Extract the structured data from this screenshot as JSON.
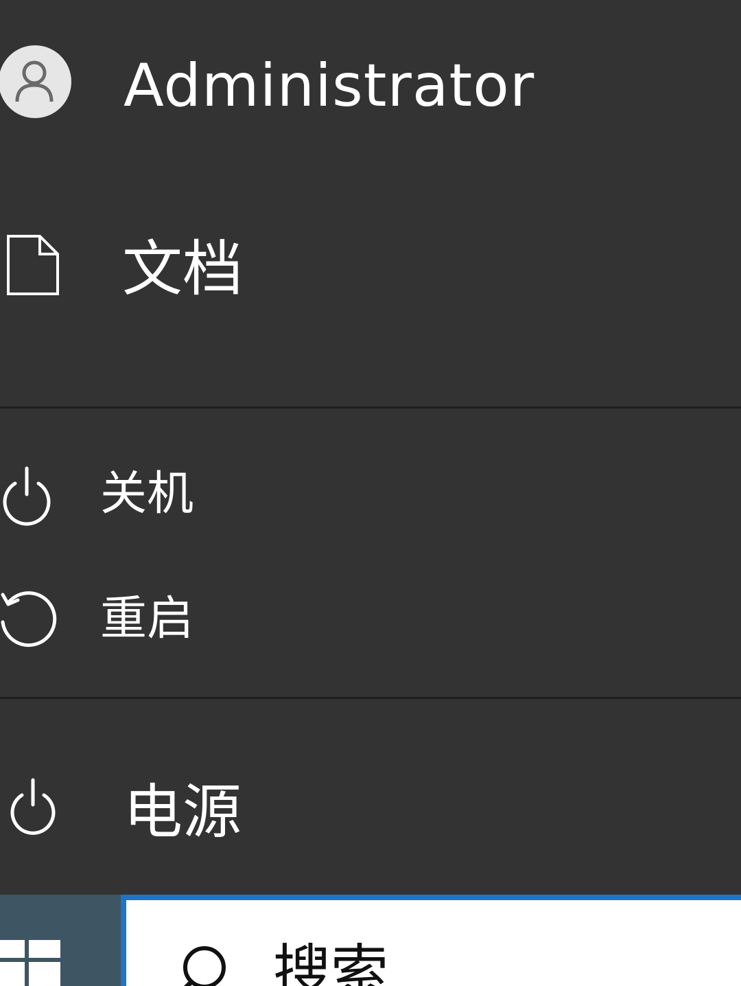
{
  "start_menu": {
    "user": {
      "name": "Administrator",
      "icon": "user-avatar-icon"
    },
    "documents": {
      "label": "文档",
      "icon": "document-icon"
    },
    "power_options": {
      "shutdown_label": "关机",
      "shutdown_icon": "power-icon",
      "restart_label": "重启",
      "restart_icon": "restart-icon"
    },
    "power": {
      "label": "电源",
      "icon": "power-icon"
    }
  },
  "taskbar": {
    "start_icon": "windows-logo-icon",
    "search_placeholder": "搜索",
    "search_icon": "search-icon"
  },
  "colors": {
    "menu_background": "#333333",
    "accent": "#1f74c6",
    "start_button": "#3e5563"
  }
}
